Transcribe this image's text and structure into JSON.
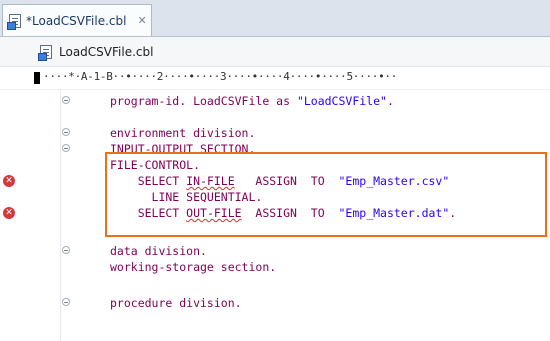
{
  "tab": {
    "label": "*LoadCSVFile.cbl",
    "close_glyph": "✕"
  },
  "breadcrumb": {
    "label": "LoadCSVFile.cbl"
  },
  "ruler": {
    "text": "····*·A-1-B··•····2····•····3····•····4····•····5····•··"
  },
  "code_lines": [
    {
      "text": "program-id. LoadCSVFile as ",
      "string": "\"LoadCSVFile\"",
      "tail": "."
    },
    {
      "text": ""
    },
    {
      "text": "environment division."
    },
    {
      "text": "INPUT-OUTPUT SECTION."
    },
    {
      "text": "FILE-CONTROL."
    },
    {
      "pre": "    SELECT ",
      "err": "IN-FILE",
      "mid": "   ASSIGN  TO  ",
      "string": "\"Emp_Master.csv\""
    },
    {
      "text": "      LINE SEQUENTIAL."
    },
    {
      "pre": "    SELECT ",
      "err": "OUT-FILE",
      "mid": "  ASSIGN  TO  ",
      "string": "\"Emp_Master.dat\"",
      "tail": "."
    },
    {
      "text": ""
    },
    {
      "text": "data division."
    },
    {
      "text": "working-storage section."
    },
    {
      "text": ""
    },
    {
      "text": "procedure division."
    }
  ],
  "icons": {
    "file": "file-icon",
    "error": "error-icon",
    "fold": "fold-toggle-icon"
  },
  "colors": {
    "keyword": "#7f0055",
    "string": "#2a00ff",
    "highlight": "#e8701b",
    "error": "#d3393b"
  }
}
